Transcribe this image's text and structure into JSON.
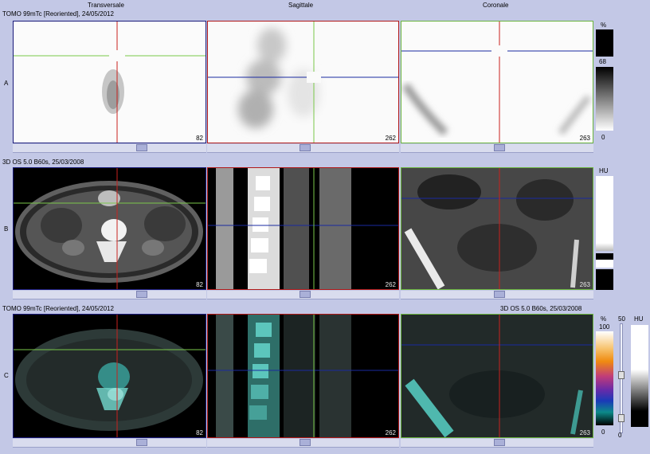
{
  "columns": {
    "transverse": "Transversale",
    "sagittal": "Sagittale",
    "coronal": "Coronale"
  },
  "rows": {
    "a": {
      "letter": "A",
      "series": "TOMO 99mTc [Reoriented], 24/05/2012"
    },
    "b": {
      "letter": "B",
      "series": "3D  OS  5.0  B60s, 25/03/2008"
    },
    "c": {
      "letter": "C",
      "series_left": "TOMO 99mTc [Reoriented], 24/05/2012",
      "series_right": "3D  OS  5.0  B60s, 25/03/2008"
    }
  },
  "slice_numbers": {
    "transverse": "82",
    "sagittal": "262",
    "coronal": "263"
  },
  "scales": {
    "a": {
      "unit": "%",
      "max": "68",
      "min": "0"
    },
    "b": {
      "unit": "HU"
    },
    "c": {
      "pct_unit": "%",
      "pct_max": "100",
      "pct_min": "0",
      "level": "50",
      "hu_unit": "HU",
      "hu_min": "0"
    }
  },
  "colors": {
    "transverse_frame": "#1a1a7a",
    "sagittal_frame": "#b01818",
    "coronal_frame": "#6ab43c",
    "cross_red": "#c8221e",
    "cross_green": "#7ac84a",
    "cross_blue": "#1a2aa0"
  }
}
